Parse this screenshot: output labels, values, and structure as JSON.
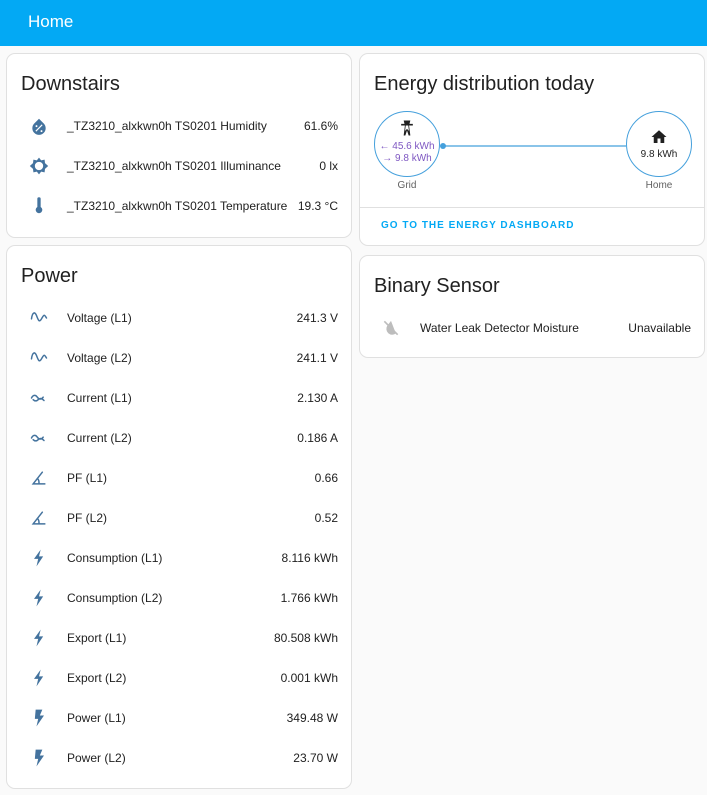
{
  "toolbar": {
    "title": "Home"
  },
  "downstairs": {
    "title": "Downstairs",
    "rows": [
      {
        "icon": "water-percent-icon",
        "name": "_TZ3210_alxkwn0h TS0201 Humidity",
        "value": "61.6%"
      },
      {
        "icon": "brightness-icon",
        "name": "_TZ3210_alxkwn0h TS0201 Illuminance",
        "value": "0 lx"
      },
      {
        "icon": "thermometer-icon",
        "name": "_TZ3210_alxkwn0h TS0201 Temperature",
        "value": "19.3 °C"
      }
    ]
  },
  "power": {
    "title": "Power",
    "rows": [
      {
        "icon": "sine-wave-icon",
        "name": "Voltage (L1)",
        "value": "241.3 V"
      },
      {
        "icon": "sine-wave-icon",
        "name": "Voltage (L2)",
        "value": "241.1 V"
      },
      {
        "icon": "current-ac-icon",
        "name": "Current (L1)",
        "value": "2.130 A"
      },
      {
        "icon": "current-ac-icon",
        "name": "Current (L2)",
        "value": "0.186 A"
      },
      {
        "icon": "angle-acute-icon",
        "name": "PF (L1)",
        "value": "0.66"
      },
      {
        "icon": "angle-acute-icon",
        "name": "PF (L2)",
        "value": "0.52"
      },
      {
        "icon": "lightning-bolt-icon",
        "name": "Consumption (L1)",
        "value": "8.116 kWh"
      },
      {
        "icon": "lightning-bolt-icon",
        "name": "Consumption (L2)",
        "value": "1.766 kWh"
      },
      {
        "icon": "lightning-bolt-icon",
        "name": "Export (L1)",
        "value": "80.508 kWh"
      },
      {
        "icon": "lightning-bolt-icon",
        "name": "Export (L2)",
        "value": "0.001 kWh"
      },
      {
        "icon": "flash-icon",
        "name": "Power (L1)",
        "value": "349.48 W"
      },
      {
        "icon": "flash-icon",
        "name": "Power (L2)",
        "value": "23.70 W"
      }
    ]
  },
  "energy": {
    "title": "Energy distribution today",
    "grid": {
      "label": "Grid",
      "in": "← 45.6 kWh",
      "out": "→ 9.8 kWh"
    },
    "home": {
      "label": "Home",
      "value": "9.8 kWh"
    },
    "link_label": "GO TO THE ENERGY DASHBOARD",
    "colors": {
      "line": "#45a0dc",
      "grid_text": "#7e57c2"
    }
  },
  "binary": {
    "title": "Binary Sensor",
    "rows": [
      {
        "icon": "water-off-icon",
        "name": "Water Leak Detector Moisture",
        "value": "Unavailable"
      }
    ]
  }
}
